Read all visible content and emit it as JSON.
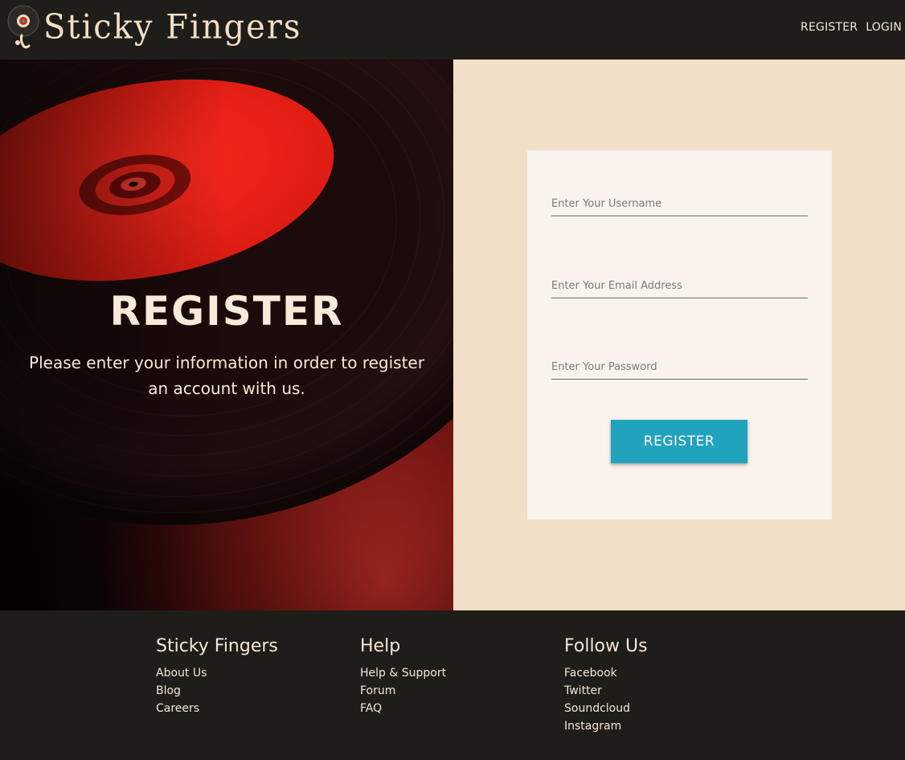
{
  "header": {
    "logo_text": "Sticky Fingers",
    "nav": [
      {
        "label": "REGISTER"
      },
      {
        "label": "LOGIN"
      }
    ]
  },
  "hero": {
    "title": "REGISTER",
    "text": "Please enter your information in order to register an account with us."
  },
  "form": {
    "username": {
      "value": "",
      "placeholder": "Enter Your Username"
    },
    "email": {
      "value": "",
      "placeholder": "Enter Your Email Address"
    },
    "password": {
      "value": "",
      "placeholder": "Enter Your Password"
    },
    "submit_label": "REGISTER"
  },
  "footer": {
    "columns": [
      {
        "heading": "Sticky Fingers",
        "links": [
          "About Us",
          "Blog",
          "Careers"
        ]
      },
      {
        "heading": "Help",
        "links": [
          "Help & Support",
          "Forum",
          "FAQ"
        ]
      },
      {
        "heading": "Follow Us",
        "links": [
          "Facebook",
          "Twitter",
          "Soundcloud",
          "Instagram"
        ]
      }
    ]
  },
  "colors": {
    "header_bg": "#1f1d1a",
    "accent_button": "#21a2bd",
    "panel_bg": "#f2dfc8",
    "card_bg": "#f9f3ec",
    "text_light": "#f3e7d6",
    "record_red": "#e01e16"
  },
  "icons": {
    "logo": "record-mascot-icon"
  }
}
